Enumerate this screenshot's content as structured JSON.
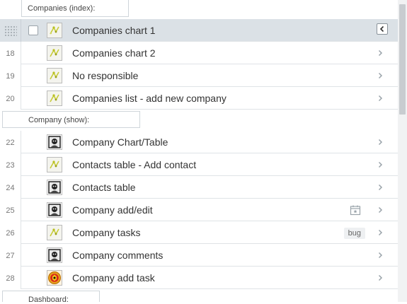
{
  "sections": [
    {
      "label": "Companies (index):"
    },
    {
      "label": "Company (show):"
    },
    {
      "label": "Dashboard:"
    }
  ],
  "rows": [
    {
      "num": "",
      "title": "Companies chart 1",
      "thumb": "yellow-sketch",
      "selected": true
    },
    {
      "num": "18",
      "title": "Companies chart 2",
      "thumb": "yellow-sketch"
    },
    {
      "num": "19",
      "title": "No responsible",
      "thumb": "yellow-sketch"
    },
    {
      "num": "20",
      "title": "Companies list - add new company",
      "thumb": "yellow-sketch"
    },
    {
      "num": "22",
      "title": "Company Chart/Table",
      "thumb": "dark-avatar"
    },
    {
      "num": "23",
      "title": "Contacts table - Add contact",
      "thumb": "yellow-sketch"
    },
    {
      "num": "24",
      "title": "Contacts table",
      "thumb": "dark-avatar"
    },
    {
      "num": "25",
      "title": "Company add/edit",
      "thumb": "dark-avatar",
      "icon": "calendar-star-icon"
    },
    {
      "num": "26",
      "title": "Company tasks",
      "thumb": "yellow-sketch",
      "badge": "bug"
    },
    {
      "num": "27",
      "title": "Company comments",
      "thumb": "dark-avatar"
    },
    {
      "num": "28",
      "title": "Company add task",
      "thumb": "red-crest"
    }
  ],
  "colors": {
    "selected_row": "#dbe1e6",
    "divider": "#dfe3e6",
    "scrollbar_thumb": "#c8ccd0"
  }
}
